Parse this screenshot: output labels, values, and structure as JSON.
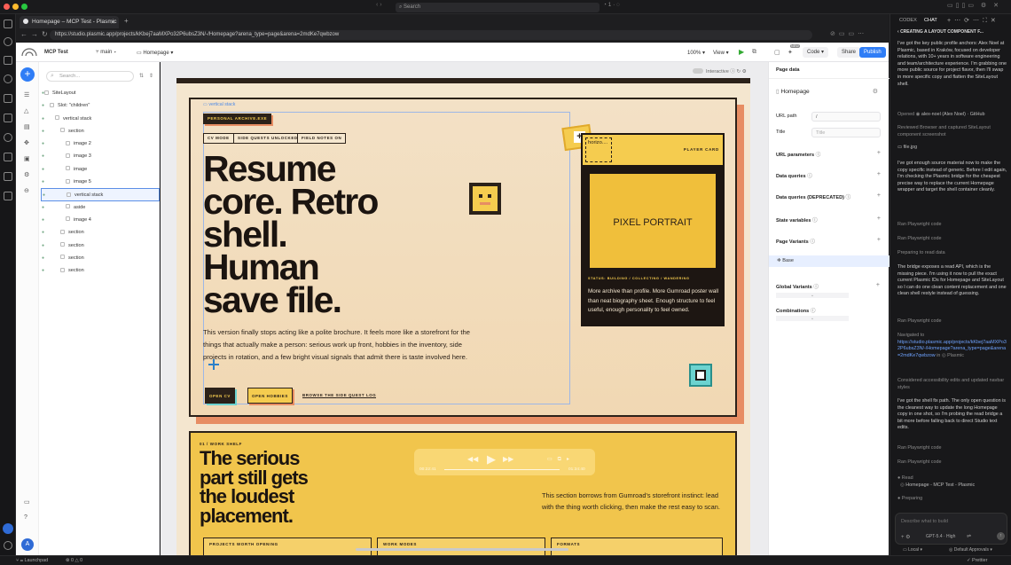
{
  "os": {
    "search": "Search"
  },
  "browser": {
    "tab_title": "Homepage – MCP Test - Plasmic",
    "url": "https://studio.plasmic.app/projects/kKbej7aaMXPo32P6ubsZ3N/-/Homepage?arena_type=page&arena=2mdKe7qwbzow"
  },
  "toolbar": {
    "project": "MCP Test",
    "branch": "main",
    "page": "Homepage",
    "zoom": "100%",
    "view": "View",
    "code": "Code",
    "share": "Share",
    "publish": "Publish",
    "new_badge": "NEW",
    "interactive": "Interactive"
  },
  "left": {
    "search_placeholder": "Search...",
    "tree": [
      {
        "label": "SiteLayout",
        "indent": 0
      },
      {
        "label": "Slot: \"children\"",
        "indent": 1
      },
      {
        "label": "vertical stack",
        "indent": 2
      },
      {
        "label": "section",
        "indent": 3
      },
      {
        "label": "image 2",
        "indent": 4
      },
      {
        "label": "image 3",
        "indent": 4
      },
      {
        "label": "image",
        "indent": 4
      },
      {
        "label": "image 5",
        "indent": 4
      },
      {
        "label": "vertical stack",
        "indent": 4
      },
      {
        "label": "aside",
        "indent": 4
      },
      {
        "label": "image 4",
        "indent": 4
      },
      {
        "label": "section",
        "indent": 3
      },
      {
        "label": "section",
        "indent": 3
      },
      {
        "label": "section",
        "indent": 3
      },
      {
        "label": "section",
        "indent": 3
      }
    ]
  },
  "canvas": {
    "sel_label": "vertical stack",
    "chip_archive": "PERSONAL ARCHIVE.EXE",
    "chips": [
      "CV MODE",
      "SIDE QUESTS UNLOCKED",
      "FIELD NOTES ON"
    ],
    "hero": [
      "Resume",
      "core. Retro",
      "shell.",
      "Human",
      "save file."
    ],
    "intro": "This version finally stops acting like a polite brochure. It feels more like a storefront for the things that actually make a person: serious work up front, hobbies in the inventory, side projects in rotation, and a few bright visual signals that admit there is taste involved here.",
    "btn_cv": "OPEN CV",
    "btn_hobbies": "OPEN HOBBIES",
    "link_side": "BROWSE THE SIDE QUEST LOG",
    "horizo": "horizo....",
    "player_card": "PLAYER CARD",
    "portrait": "PIXEL PORTRAIT",
    "status": "STATUS: BUILDING / COLLECTING / WANDERING",
    "card_text": "More archive than profile. More Gumroad poster wall than neat biography sheet. Enough structure to feel useful, enough personality to feel owned.",
    "work_kicker": "01 / WORK SHELF",
    "work_title": [
      "The serious",
      "part still gets",
      "the loudest",
      "placement."
    ],
    "work_text": "This section borrows from Gumroad's storefront instinct: lead with the thing worth clicking, then make the rest easy to scan.",
    "player": {
      "t0": "00:22:41",
      "t1": "01:34:40"
    },
    "stats": [
      "PROJECTS WORTH OPENING",
      "WORK MODES",
      "FORMATS"
    ]
  },
  "right": {
    "header": "Page data",
    "page": "Homepage",
    "url_path_label": "URL path",
    "url_path_value": "/",
    "title_label": "Title",
    "title_placeholder": "Title",
    "sections": [
      "URL parameters",
      "Data queries",
      "Data queries (DEPRECATED)",
      "State variables",
      "Page Variants"
    ],
    "base": "Base",
    "global_variants": "Global Variants",
    "combinations": "Combinations"
  },
  "chat": {
    "tab_codex": "CODEX",
    "tab_chat": "CHAT",
    "heading": "CREATING A LAYOUT COMPONENT F...",
    "p1": "I've got the key public profile anchors: Alex Noel at Plasmic, based in Kraków, focused on developer relations, with 10+ years in software engineering and team/architecture experience. I'm grabbing one more public source for project flavor, then I'll swap in more specific copy and flatten the SiteLayout shell.",
    "opened": "Opened",
    "opened_item": "alex-noel (Alex Noel) · GitHub",
    "reviewed": "Reviewed Browser and captured SiteLayout component screenshot",
    "file": "file.jpg",
    "p2": "I've got enough source material now to make the copy specific instead of generic. Before I edit again, I'm checking the Plasmic bridge for the cheapest precise way to replace the current Homepage wrapper and target the shell container cleanly.",
    "ran1": "Ran Playwright code",
    "ran2": "Ran Playwright code",
    "preparing": "Preparing to read data",
    "p3": "The bridge exposes a read API, which is the missing piece. I'm using it now to pull the exact current Plasmic IDs for Homepage and SiteLayout so I can do one clean content replacement and one clean shell restyle instead of guessing.",
    "ran3": "Ran Playwright code",
    "navigated": "Navigated to",
    "nav_url": "https://studio.plasmic.app/projects/kKbej7aaMXPo32P6ubsZ3N/-/Homepage?arena_type=page&arena=2mdKe7qwbzow",
    "nav_in": "in",
    "nav_site": "Plasmic",
    "considered": "Considered accessibility edits and updated navbar styles",
    "p4": "I've got the shell fix path. The only open question is the cleanest way to update the long Homepage copy in one shot, so I'm probing the read bridge a bit more before falling back to direct Studio text edits.",
    "ran4": "Ran Playwright code",
    "ran5": "Ran Playwright code",
    "read": "Read",
    "read_item": "Homepage - MCP Test - Plasmic",
    "preparing2": "Preparing",
    "input_placeholder": "Describe what to build",
    "model": "GPT-5.4 · High",
    "local": "Local",
    "approvals": "Default Approvals"
  },
  "status": {
    "launchpad": "Launchpad",
    "errors": "0",
    "warnings": "0",
    "prettier": "Prettier"
  },
  "colors": {
    "accent": "#2f7df6",
    "hero_bg": "#f3e1c6",
    "yellow": "#f5cc4f",
    "orange": "#e78d63",
    "teal": "#6cd3d0"
  }
}
